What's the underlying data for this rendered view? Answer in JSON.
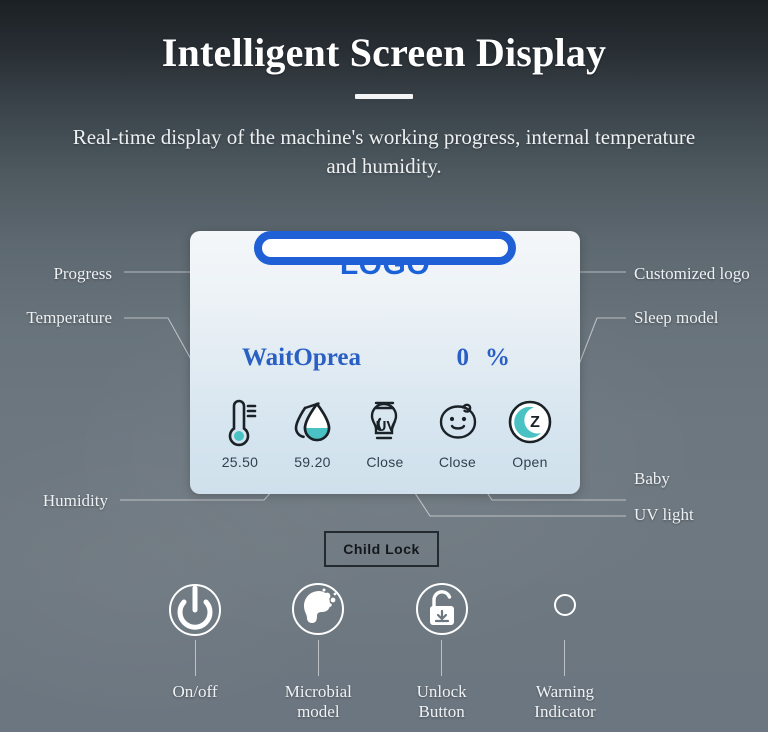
{
  "header": {
    "title": "Intelligent Screen Display",
    "subtitle": "Real-time display of the machine's working progress, internal temperature and humidity."
  },
  "colors": {
    "accent_blue": "#1f60d6",
    "logo_blue": "#1b62d8",
    "status_blue": "#2a5fc4",
    "icon_teal": "#4ac2c4",
    "panel_top": "#f4f7f9",
    "panel_bottom": "#cfe0ec",
    "label_white": "#eef1f3",
    "child_lock_border": "#242b30"
  },
  "screen": {
    "logo_text": "LOGO",
    "progress": {
      "value": 0,
      "unit": "%",
      "status_label": "WaitOprea",
      "value_text": "0",
      "unit_text": "%"
    },
    "indicators": [
      {
        "icon": "thermometer-icon",
        "value": "25.50",
        "name": "temperature"
      },
      {
        "icon": "water-drop-icon",
        "value": "59.20",
        "name": "humidity"
      },
      {
        "icon": "uv-lamp-icon",
        "value": "Close",
        "name": "uv-light"
      },
      {
        "icon": "baby-face-icon",
        "value": "Close",
        "name": "baby"
      },
      {
        "icon": "sleep-moon-icon",
        "value": "Open",
        "name": "sleep-model"
      }
    ]
  },
  "child_lock": {
    "label": "Child Lock"
  },
  "annotations": {
    "left": [
      {
        "label": "Progress",
        "name": "annotation-progress"
      },
      {
        "label": "Temperature",
        "name": "annotation-temperature"
      },
      {
        "label": "Humidity",
        "name": "annotation-humidity"
      }
    ],
    "right": [
      {
        "label": "Customized logo",
        "name": "annotation-customized-logo"
      },
      {
        "label": "Sleep model",
        "name": "annotation-sleep-model"
      },
      {
        "label": "Baby",
        "name": "annotation-baby"
      },
      {
        "label": "UV light",
        "name": "annotation-uv-light"
      }
    ]
  },
  "controls": [
    {
      "icon": "power-icon",
      "label": "On/off",
      "name": "on-off-button"
    },
    {
      "icon": "microbe-head-icon",
      "label": "Microbial\nmodel",
      "label_l1": "Microbial",
      "label_l2": "model",
      "name": "microbial-model-button"
    },
    {
      "icon": "unlock-padlock-icon",
      "label": "Unlock\nButton",
      "label_l1": "Unlock",
      "label_l2": "Button",
      "name": "unlock-button"
    },
    {
      "icon": "indicator-dot-icon",
      "label": "Warning\nIndicator",
      "label_l1": "Warning",
      "label_l2": "Indicator",
      "name": "warning-indicator"
    }
  ]
}
